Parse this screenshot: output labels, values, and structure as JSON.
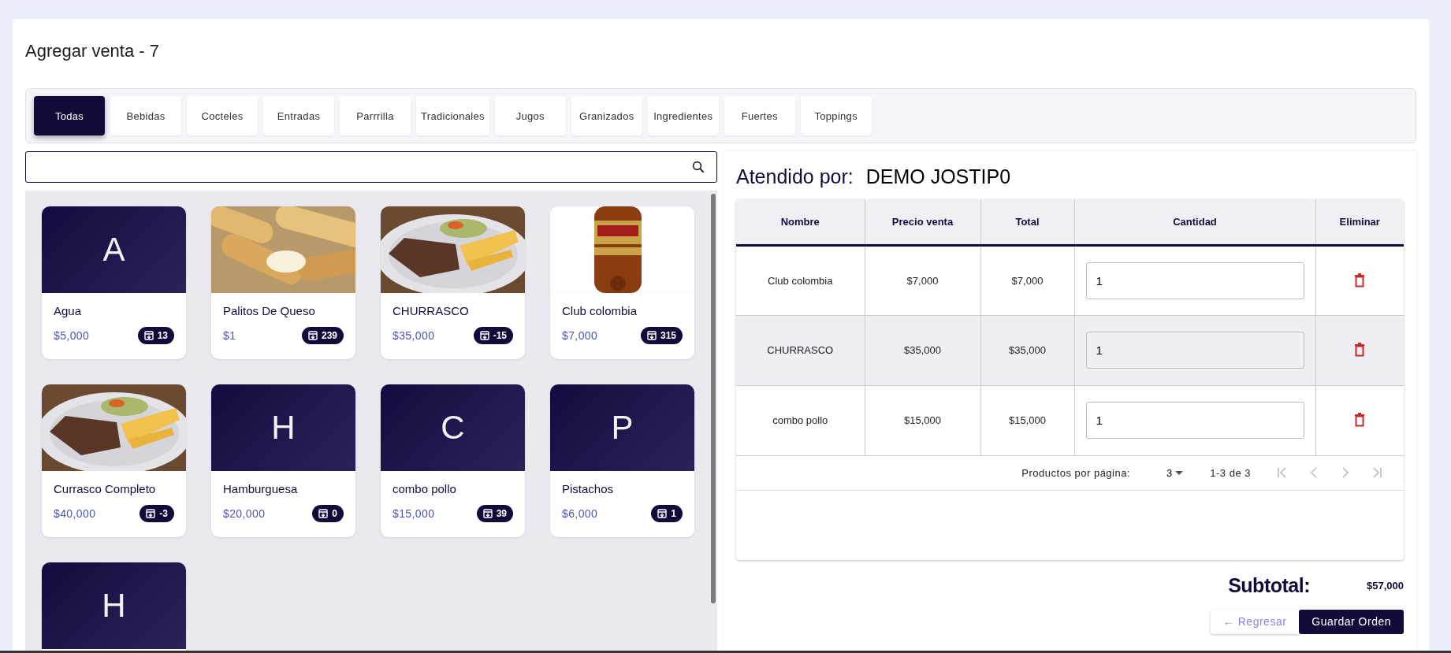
{
  "page": {
    "title": "Agregar venta - 7"
  },
  "tabs": [
    {
      "label": "Todas",
      "selected": true
    },
    {
      "label": "Bebidas",
      "selected": false
    },
    {
      "label": "Cocteles",
      "selected": false
    },
    {
      "label": "Entradas",
      "selected": false
    },
    {
      "label": "Parrrilla",
      "selected": false
    },
    {
      "label": "Tradicionales",
      "selected": false
    },
    {
      "label": "Jugos",
      "selected": false
    },
    {
      "label": "Granizados",
      "selected": false
    },
    {
      "label": "Ingredientes",
      "selected": false
    },
    {
      "label": "Fuertes",
      "selected": false
    },
    {
      "label": "Toppings",
      "selected": false
    }
  ],
  "products": [
    {
      "image": {
        "kind": "letter",
        "letter": "A"
      },
      "name": "Agua",
      "price": "$5,000",
      "stock": "13"
    },
    {
      "name": "Palitos De Queso",
      "price": "$1",
      "stock": "239"
    },
    {
      "name": "CHURRASCO",
      "price": "$35,000",
      "stock": "-15"
    },
    {
      "name": "Club colombia",
      "price": "$7,000",
      "stock": "315"
    },
    {
      "name": "Currasco Completo",
      "price": "$40,000",
      "stock": "-3"
    },
    {
      "image": {
        "kind": "letter",
        "letter": "H"
      },
      "name": "Hamburguesa",
      "price": "$20,000",
      "stock": "0"
    },
    {
      "image": {
        "kind": "letter",
        "letter": "C"
      },
      "name": "combo pollo",
      "price": "$15,000",
      "stock": "39"
    },
    {
      "image": {
        "kind": "letter",
        "letter": "P"
      },
      "name": "Pistachos",
      "price": "$6,000",
      "stock": "1"
    },
    {
      "image": {
        "kind": "letter",
        "letter": "H"
      }
    }
  ],
  "order": {
    "attended_label": "Atendido por:",
    "attended_name": "DEMO JOSTIP0",
    "columns": [
      "Nombre",
      "Precio venta",
      "Total",
      "Cantidad",
      "Eliminar"
    ],
    "rows": [
      {
        "name": "Club colombia",
        "price": "$7,000",
        "total": "$7,000",
        "quantity": "1",
        "selected": false
      },
      {
        "name": "CHURRASCO",
        "price": "$35,000",
        "total": "$35,000",
        "quantity": "1",
        "selected": true
      },
      {
        "name": "combo pollo",
        "price": "$15,000",
        "total": "$15,000",
        "quantity": "1",
        "selected": false
      }
    ],
    "pagination": {
      "label": "Productos por página:",
      "per_page": "3",
      "range": "1-3 de 3"
    },
    "subtotal_label": "Subtotal:",
    "subtotal": "$57,000",
    "buttons": {
      "back": "← Regresar",
      "save": "Guardar Orden"
    }
  }
}
